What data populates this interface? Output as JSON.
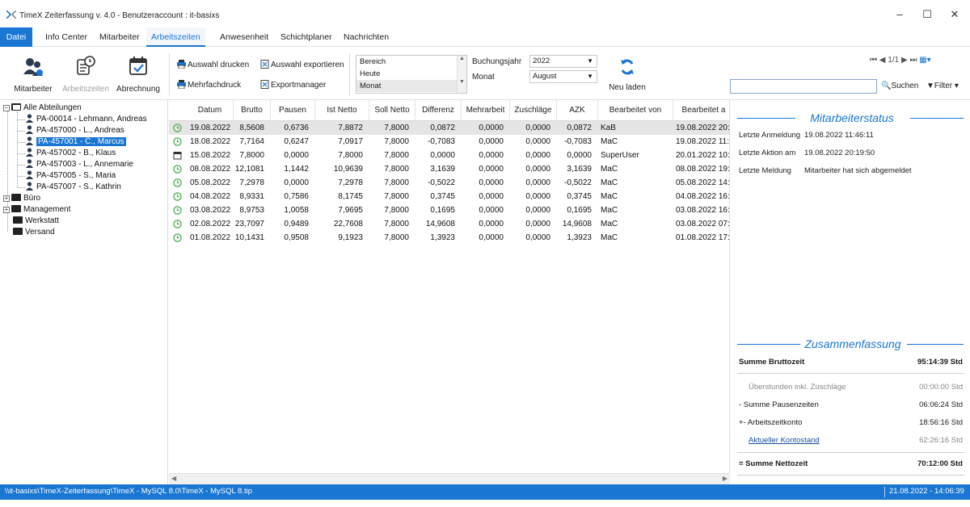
{
  "window": {
    "title": "TimeX Zeiterfassung v. 4.0 - Benutzeraccount : it-basixs",
    "minimize_glyph": "–",
    "maximize_glyph": "☐",
    "close_glyph": "✕"
  },
  "menu": {
    "file": "Datei",
    "items": [
      "Info Center",
      "Mitarbeiter",
      "Arbeitszeiten",
      "Anwesenheit",
      "Schichtplaner",
      "Nachrichten"
    ],
    "active": "Arbeitszeiten"
  },
  "ribbon": {
    "mitarbeiter": "Mitarbeiter",
    "arbeitszeiten": "Arbeitszeiten",
    "abrechnung": "Abrechnung",
    "auswahl_drucken": "Auswahl drucken",
    "auswahl_exportieren": "Auswahl exportieren",
    "mehrfachdruck": "Mehrfachdruck",
    "exportmanager": "Exportmanager",
    "bereich_options": [
      "Bereich",
      "Heute",
      "Monat"
    ],
    "bereich_selected": "Monat",
    "buchungsjahr_label": "Buchungsjahr",
    "buchungsjahr_value": "2022",
    "monat_label": "Monat",
    "monat_value": "August",
    "neu_laden": "Neu laden",
    "pager": "1/1",
    "search_button": "Suchen",
    "search_value": "",
    "filter_button": "Filter"
  },
  "tree": {
    "root": "Alle Abteilungen",
    "employees": [
      "PA-00014 - Lehmann, Andreas",
      "PA-457000 - L., Andreas",
      "PA-457001 - C., Marcus",
      "PA-457002 - B., Klaus",
      "PA-457003 - L., Annemarie",
      "PA-457005 - S., Maria",
      "PA-457007 - S., Kathrin"
    ],
    "selected_employee": "PA-457001 - C., Marcus",
    "departments": [
      "Büro",
      "Management",
      "Werkstatt",
      "Versand"
    ]
  },
  "grid": {
    "columns": [
      "Datum",
      "Brutto",
      "Pausen",
      "Ist Netto",
      "Soll Netto",
      "Differenz",
      "Mehrarbeit",
      "Zuschläge",
      "AZK",
      "Bearbeitet von",
      "Bearbeitet a"
    ],
    "rows": [
      {
        "icon": "clock",
        "cells": [
          "19.08.2022",
          "8,5608",
          "0,6736",
          "7,8872",
          "7,8000",
          "0,0872",
          "0,0000",
          "0,0000",
          "0,0872",
          "KaB",
          "19.08.2022 20:"
        ]
      },
      {
        "icon": "clock",
        "cells": [
          "18.08.2022",
          "7,7164",
          "0,6247",
          "7,0917",
          "7,8000",
          "-0,7083",
          "0,0000",
          "0,0000",
          "-0,7083",
          "MaC",
          "19.08.2022 11:4"
        ]
      },
      {
        "icon": "calendar",
        "cells": [
          "15.08.2022",
          "7,8000",
          "0,0000",
          "7,8000",
          "7,8000",
          "0,0000",
          "0,0000",
          "0,0000",
          "0,0000",
          "SuperUser",
          "20.01.2022 10:"
        ]
      },
      {
        "icon": "clock",
        "cells": [
          "08.08.2022",
          "12,1081",
          "1,1442",
          "10,9639",
          "7,8000",
          "3,1639",
          "0,0000",
          "0,0000",
          "3,1639",
          "MaC",
          "08.08.2022 19:"
        ]
      },
      {
        "icon": "clock",
        "cells": [
          "05.08.2022",
          "7,2978",
          "0,0000",
          "7,2978",
          "7,8000",
          "-0,5022",
          "0,0000",
          "0,0000",
          "-0,5022",
          "MaC",
          "05.08.2022 14:"
        ]
      },
      {
        "icon": "clock",
        "cells": [
          "04.08.2022",
          "8,9331",
          "0,7586",
          "8,1745",
          "7,8000",
          "0,3745",
          "0,0000",
          "0,0000",
          "0,3745",
          "MaC",
          "04.08.2022 16:"
        ]
      },
      {
        "icon": "clock",
        "cells": [
          "03.08.2022",
          "8,9753",
          "1,0058",
          "7,9695",
          "7,8000",
          "0,1695",
          "0,0000",
          "0,0000",
          "0,1695",
          "MaC",
          "03.08.2022 16:"
        ]
      },
      {
        "icon": "clock",
        "cells": [
          "02.08.2022",
          "23,7097",
          "0,9489",
          "22,7608",
          "7,8000",
          "14,9608",
          "0,0000",
          "0,0000",
          "14,9608",
          "MaC",
          "03.08.2022 07:"
        ]
      },
      {
        "icon": "clock",
        "cells": [
          "01.08.2022",
          "10,1431",
          "0,9508",
          "9,1923",
          "7,8000",
          "1,3923",
          "0,0000",
          "0,0000",
          "1,3923",
          "MaC",
          "01.08.2022 17:"
        ]
      }
    ]
  },
  "status_panel": {
    "title": "Mitarbeiterstatus",
    "letzte_anmeldung_label": "Letzte Anmeldung",
    "letzte_anmeldung_value": "19.08.2022 11:46:11",
    "letzte_aktion_label": "Letzte Aktion am",
    "letzte_aktion_value": "19.08.2022 20:19:50",
    "letzte_meldung_label": "Letzte Meldung",
    "letzte_meldung_value": "Mitarbeiter hat sich abgemeldet"
  },
  "summary": {
    "title": "Zusammenfassung",
    "summe_bruttozeit_label": "Summe Bruttozeit",
    "summe_bruttozeit_value": "95:14:39 Std",
    "ueberstunden_label": "Überstunden inkl. Zuschläge",
    "ueberstunden_value": "00:00:00 Std",
    "pausen_label": "-  Summe Pausenzeiten",
    "pausen_value": "06:06:24 Std",
    "konto_label": "+- Arbeitszeitkonto",
    "konto_value": "18:56:16 Std",
    "kontostand_label": "Aktueller Kontostand",
    "kontostand_value": "62:26:16 Std",
    "netto_label": "=  Summe Nettozeit",
    "netto_value": "70:12:00 Std"
  },
  "statusbar": {
    "path": "\\\\it-basixs\\TimeX-Zeiterfassung\\TimeX - MySQL 8.0\\TimeX - MySQL 8.tip",
    "datetime": "21.08.2022 - 14:06:39"
  },
  "colors": {
    "accent": "#1976d2",
    "clock_green": "#4caf50"
  }
}
